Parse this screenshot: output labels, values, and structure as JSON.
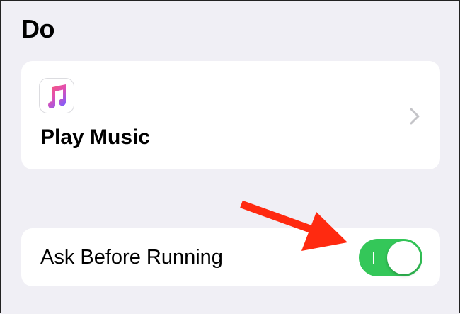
{
  "section": {
    "title": "Do"
  },
  "action": {
    "label": "Play Music",
    "icon": "music-note-icon",
    "chevron_icon": "chevron-right-icon"
  },
  "setting": {
    "label": "Ask Before Running",
    "enabled": true,
    "on_color": "#34c759"
  },
  "annotation": {
    "icon": "red-arrow-icon",
    "color": "#ff2a10"
  }
}
